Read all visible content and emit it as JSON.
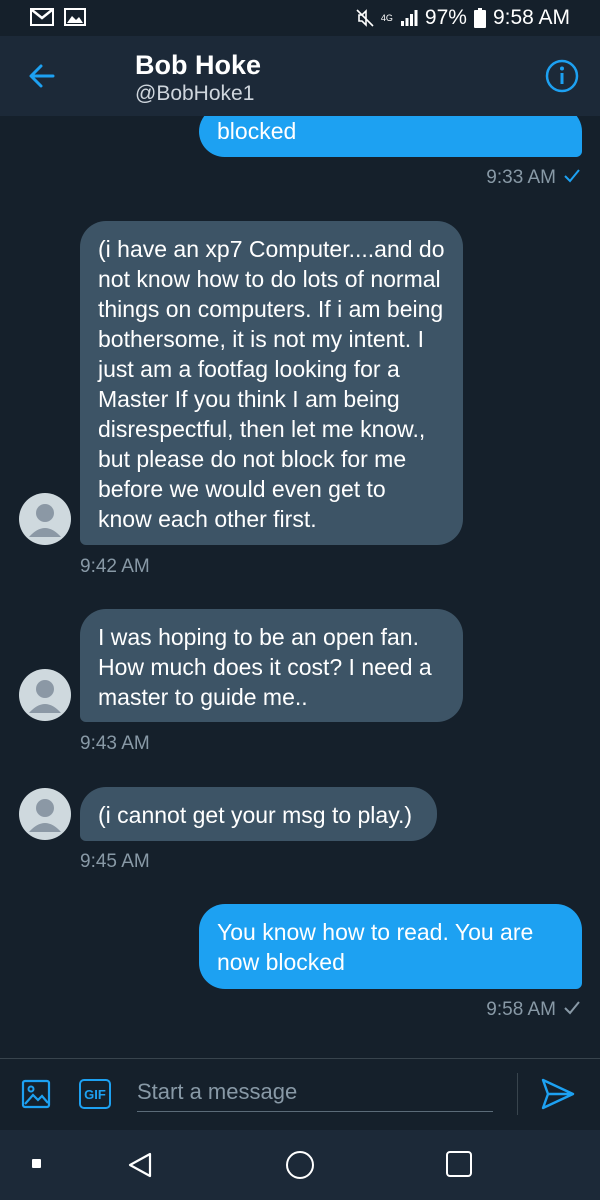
{
  "status_bar": {
    "battery": "97%",
    "time": "9:58 AM",
    "network": "4G",
    "icons": [
      "gmail-icon",
      "gallery-icon",
      "mute-icon",
      "signal-icon",
      "battery-icon"
    ]
  },
  "header": {
    "name": "Bob Hoke",
    "handle": "@BobHoke1",
    "icons": [
      "back-arrow-icon",
      "info-icon"
    ]
  },
  "messages": [
    {
      "id": 0,
      "sender": "me",
      "text": "blocked",
      "time": "9:33 AM",
      "read_check": true
    },
    {
      "id": 1,
      "sender": "them",
      "text": "(i have an xp7 Computer....and do not know how to do lots of normal things on computers.  If i am being bothersome, it is not my intent.   I just am a footfag looking for a Master  If you  think I am being disrespectful, then let me know., but please do not block for me before we would even get to know each other first.",
      "time": "9:42 AM"
    },
    {
      "id": 2,
      "sender": "them",
      "text": "I was hoping to be an open fan.  How much does it cost?  I need a master to guide me..",
      "time": "9:43 AM"
    },
    {
      "id": 3,
      "sender": "them",
      "text": "(i cannot get your msg to play.)",
      "time": "9:45 AM"
    },
    {
      "id": 4,
      "sender": "me",
      "text": "You know how to read. You are now blocked",
      "time": "9:58 AM",
      "read_check": true
    }
  ],
  "composer": {
    "placeholder": "Start a message",
    "gif_label": "GIF",
    "icons": [
      "image-icon",
      "gif-icon",
      "send-icon"
    ]
  },
  "colors": {
    "background": "#15202b",
    "header": "#1c2938",
    "accent": "#1da1f2",
    "received_bubble": "#3d5466",
    "muted_text": "#8899a6"
  }
}
